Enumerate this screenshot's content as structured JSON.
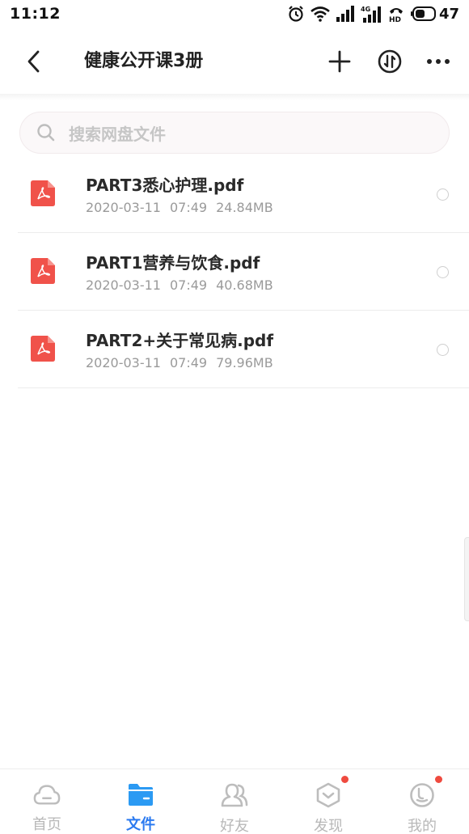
{
  "status_bar": {
    "time": "11:12",
    "network": "4G",
    "battery": "47"
  },
  "header": {
    "title": "健康公开课3册"
  },
  "search": {
    "placeholder": "搜索网盘文件"
  },
  "files": [
    {
      "name": "PART3悉心护理.pdf",
      "date": "2020-03-11",
      "time": "07:49",
      "size": "24.84MB",
      "icon": "pdf-icon"
    },
    {
      "name": "PART1营养与饮食.pdf",
      "date": "2020-03-11",
      "time": "07:49",
      "size": "40.68MB",
      "icon": "pdf-icon"
    },
    {
      "name": "PART2+关于常见病.pdf",
      "date": "2020-03-11",
      "time": "07:49",
      "size": "79.96MB",
      "icon": "pdf-icon"
    }
  ],
  "bottom_nav": [
    {
      "label": "首页",
      "icon": "cloud-icon",
      "active": false,
      "badge": false
    },
    {
      "label": "文件",
      "icon": "folder-icon",
      "active": true,
      "badge": false
    },
    {
      "label": "好友",
      "icon": "friends-icon",
      "active": false,
      "badge": false
    },
    {
      "label": "发现",
      "icon": "discover-icon",
      "active": false,
      "badge": true
    },
    {
      "label": "我的",
      "icon": "profile-icon",
      "active": false,
      "badge": true
    }
  ],
  "colors": {
    "accent": "#2b7af0",
    "pdf": "#f0524a",
    "badge": "#ef4a3f",
    "inactive": "#b8b8b8"
  }
}
